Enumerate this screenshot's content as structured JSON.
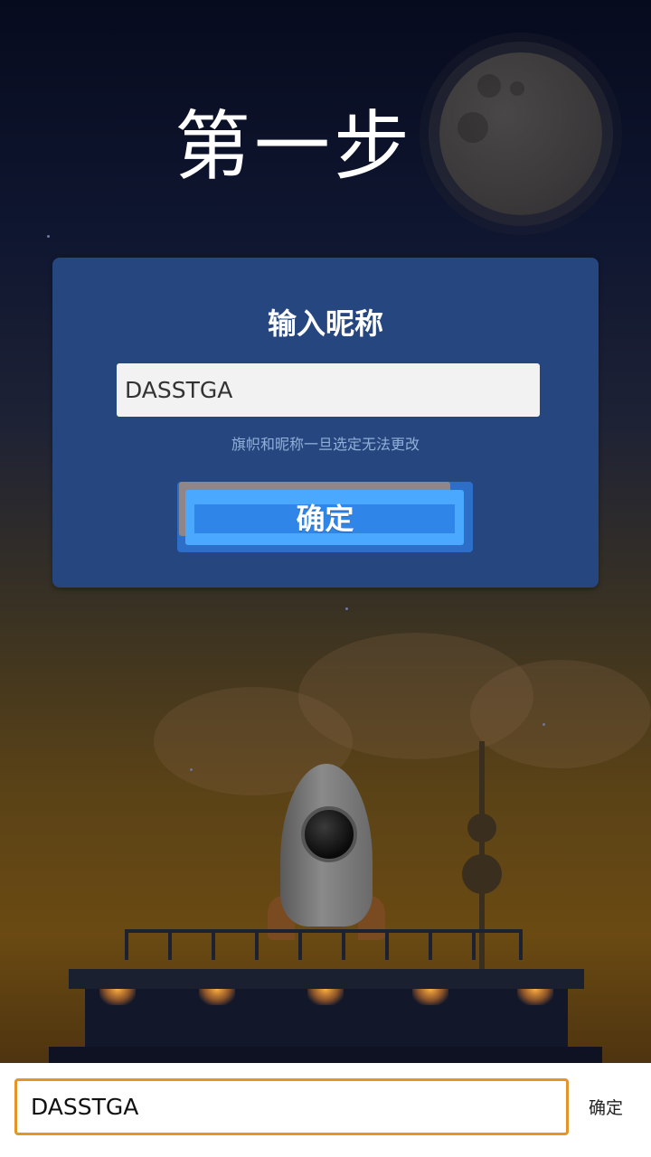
{
  "title": "第一步",
  "dialog": {
    "heading": "输入昵称",
    "nickname_value": "DASSTGA",
    "hint": "旗帜和昵称一旦选定无法更改",
    "confirm_label": "确定"
  },
  "ime_bar": {
    "input_value": "DASSTGA",
    "confirm_label": "确定"
  },
  "colors": {
    "dialog_bg": "#26467f",
    "button_blue": "#4aa9ff",
    "ime_input_border": "#e4952a"
  }
}
